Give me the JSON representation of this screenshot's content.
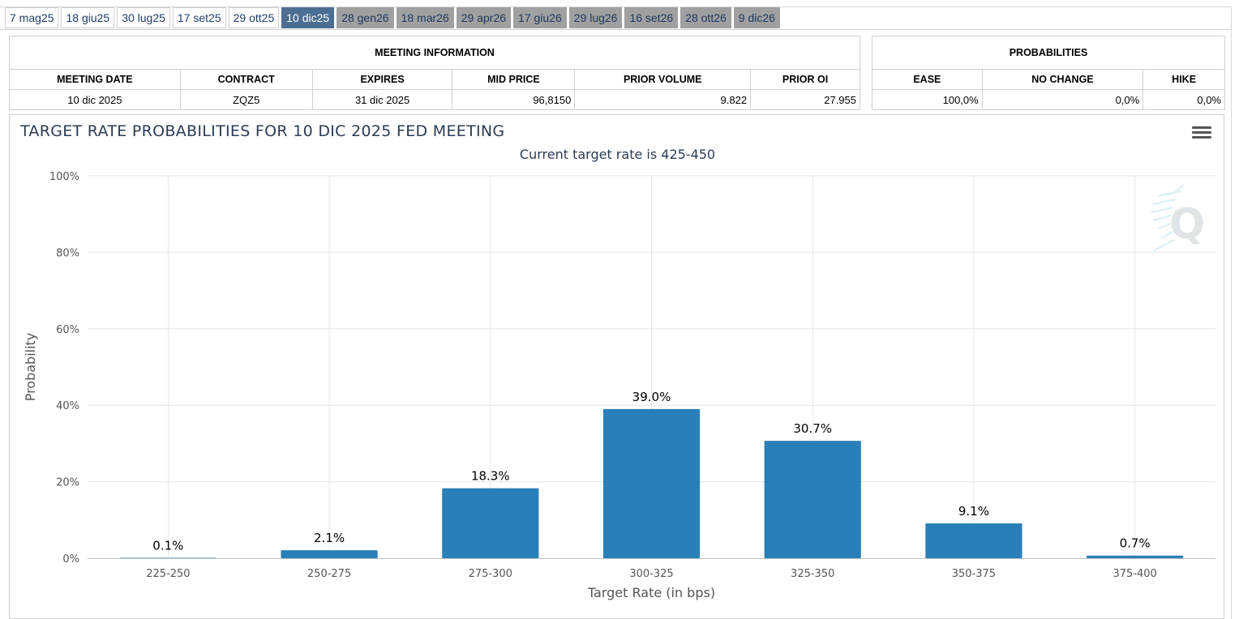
{
  "tabs": [
    {
      "label": "7 mag25",
      "state": "past"
    },
    {
      "label": "18 giu25",
      "state": "past"
    },
    {
      "label": "30 lug25",
      "state": "past"
    },
    {
      "label": "17 set25",
      "state": "past"
    },
    {
      "label": "29 ott25",
      "state": "past"
    },
    {
      "label": "10 dic25",
      "state": "active"
    },
    {
      "label": "28 gen26",
      "state": "future"
    },
    {
      "label": "18 mar26",
      "state": "future"
    },
    {
      "label": "29 apr26",
      "state": "future"
    },
    {
      "label": "17 giu26",
      "state": "future"
    },
    {
      "label": "29 lug26",
      "state": "future"
    },
    {
      "label": "16 set26",
      "state": "future"
    },
    {
      "label": "28 ott26",
      "state": "future"
    },
    {
      "label": "9 dic26",
      "state": "future"
    }
  ],
  "meeting_info": {
    "heading": "MEETING INFORMATION",
    "columns": [
      "MEETING DATE",
      "CONTRACT",
      "EXPIRES",
      "MID PRICE",
      "PRIOR VOLUME",
      "PRIOR OI"
    ],
    "row": [
      "10 dic 2025",
      "ZQZ5",
      "31 dic 2025",
      "96,8150",
      "9.822",
      "27.955"
    ]
  },
  "probabilities": {
    "heading": "PROBABILITIES",
    "columns": [
      "EASE",
      "NO CHANGE",
      "HIKE"
    ],
    "row": [
      "100,0%",
      "0,0%",
      "0,0%"
    ]
  },
  "chart": {
    "title": "TARGET RATE PROBABILITIES FOR 10 DIC 2025 FED MEETING",
    "subtitle": "Current target rate is 425-450",
    "menu_icon": "hamburger-menu-icon",
    "watermark_icon": "cme-q-logo"
  },
  "chart_data": {
    "type": "bar",
    "categories": [
      "225-250",
      "250-275",
      "275-300",
      "300-325",
      "325-350",
      "350-375",
      "375-400"
    ],
    "values": [
      0.1,
      2.1,
      18.3,
      39.0,
      30.7,
      9.1,
      0.7
    ],
    "data_labels": [
      "0.1%",
      "2.1%",
      "18.3%",
      "39.0%",
      "30.7%",
      "9.1%",
      "0.7%"
    ],
    "xlabel": "Target Rate (in bps)",
    "ylabel": "Probability",
    "ylim": [
      0,
      100
    ],
    "yticks": [
      "0%",
      "20%",
      "40%",
      "60%",
      "80%",
      "100%"
    ],
    "ytick_values": [
      0,
      20,
      40,
      60,
      80,
      100
    ],
    "bar_color": "#2a7fb8",
    "grid": true
  }
}
